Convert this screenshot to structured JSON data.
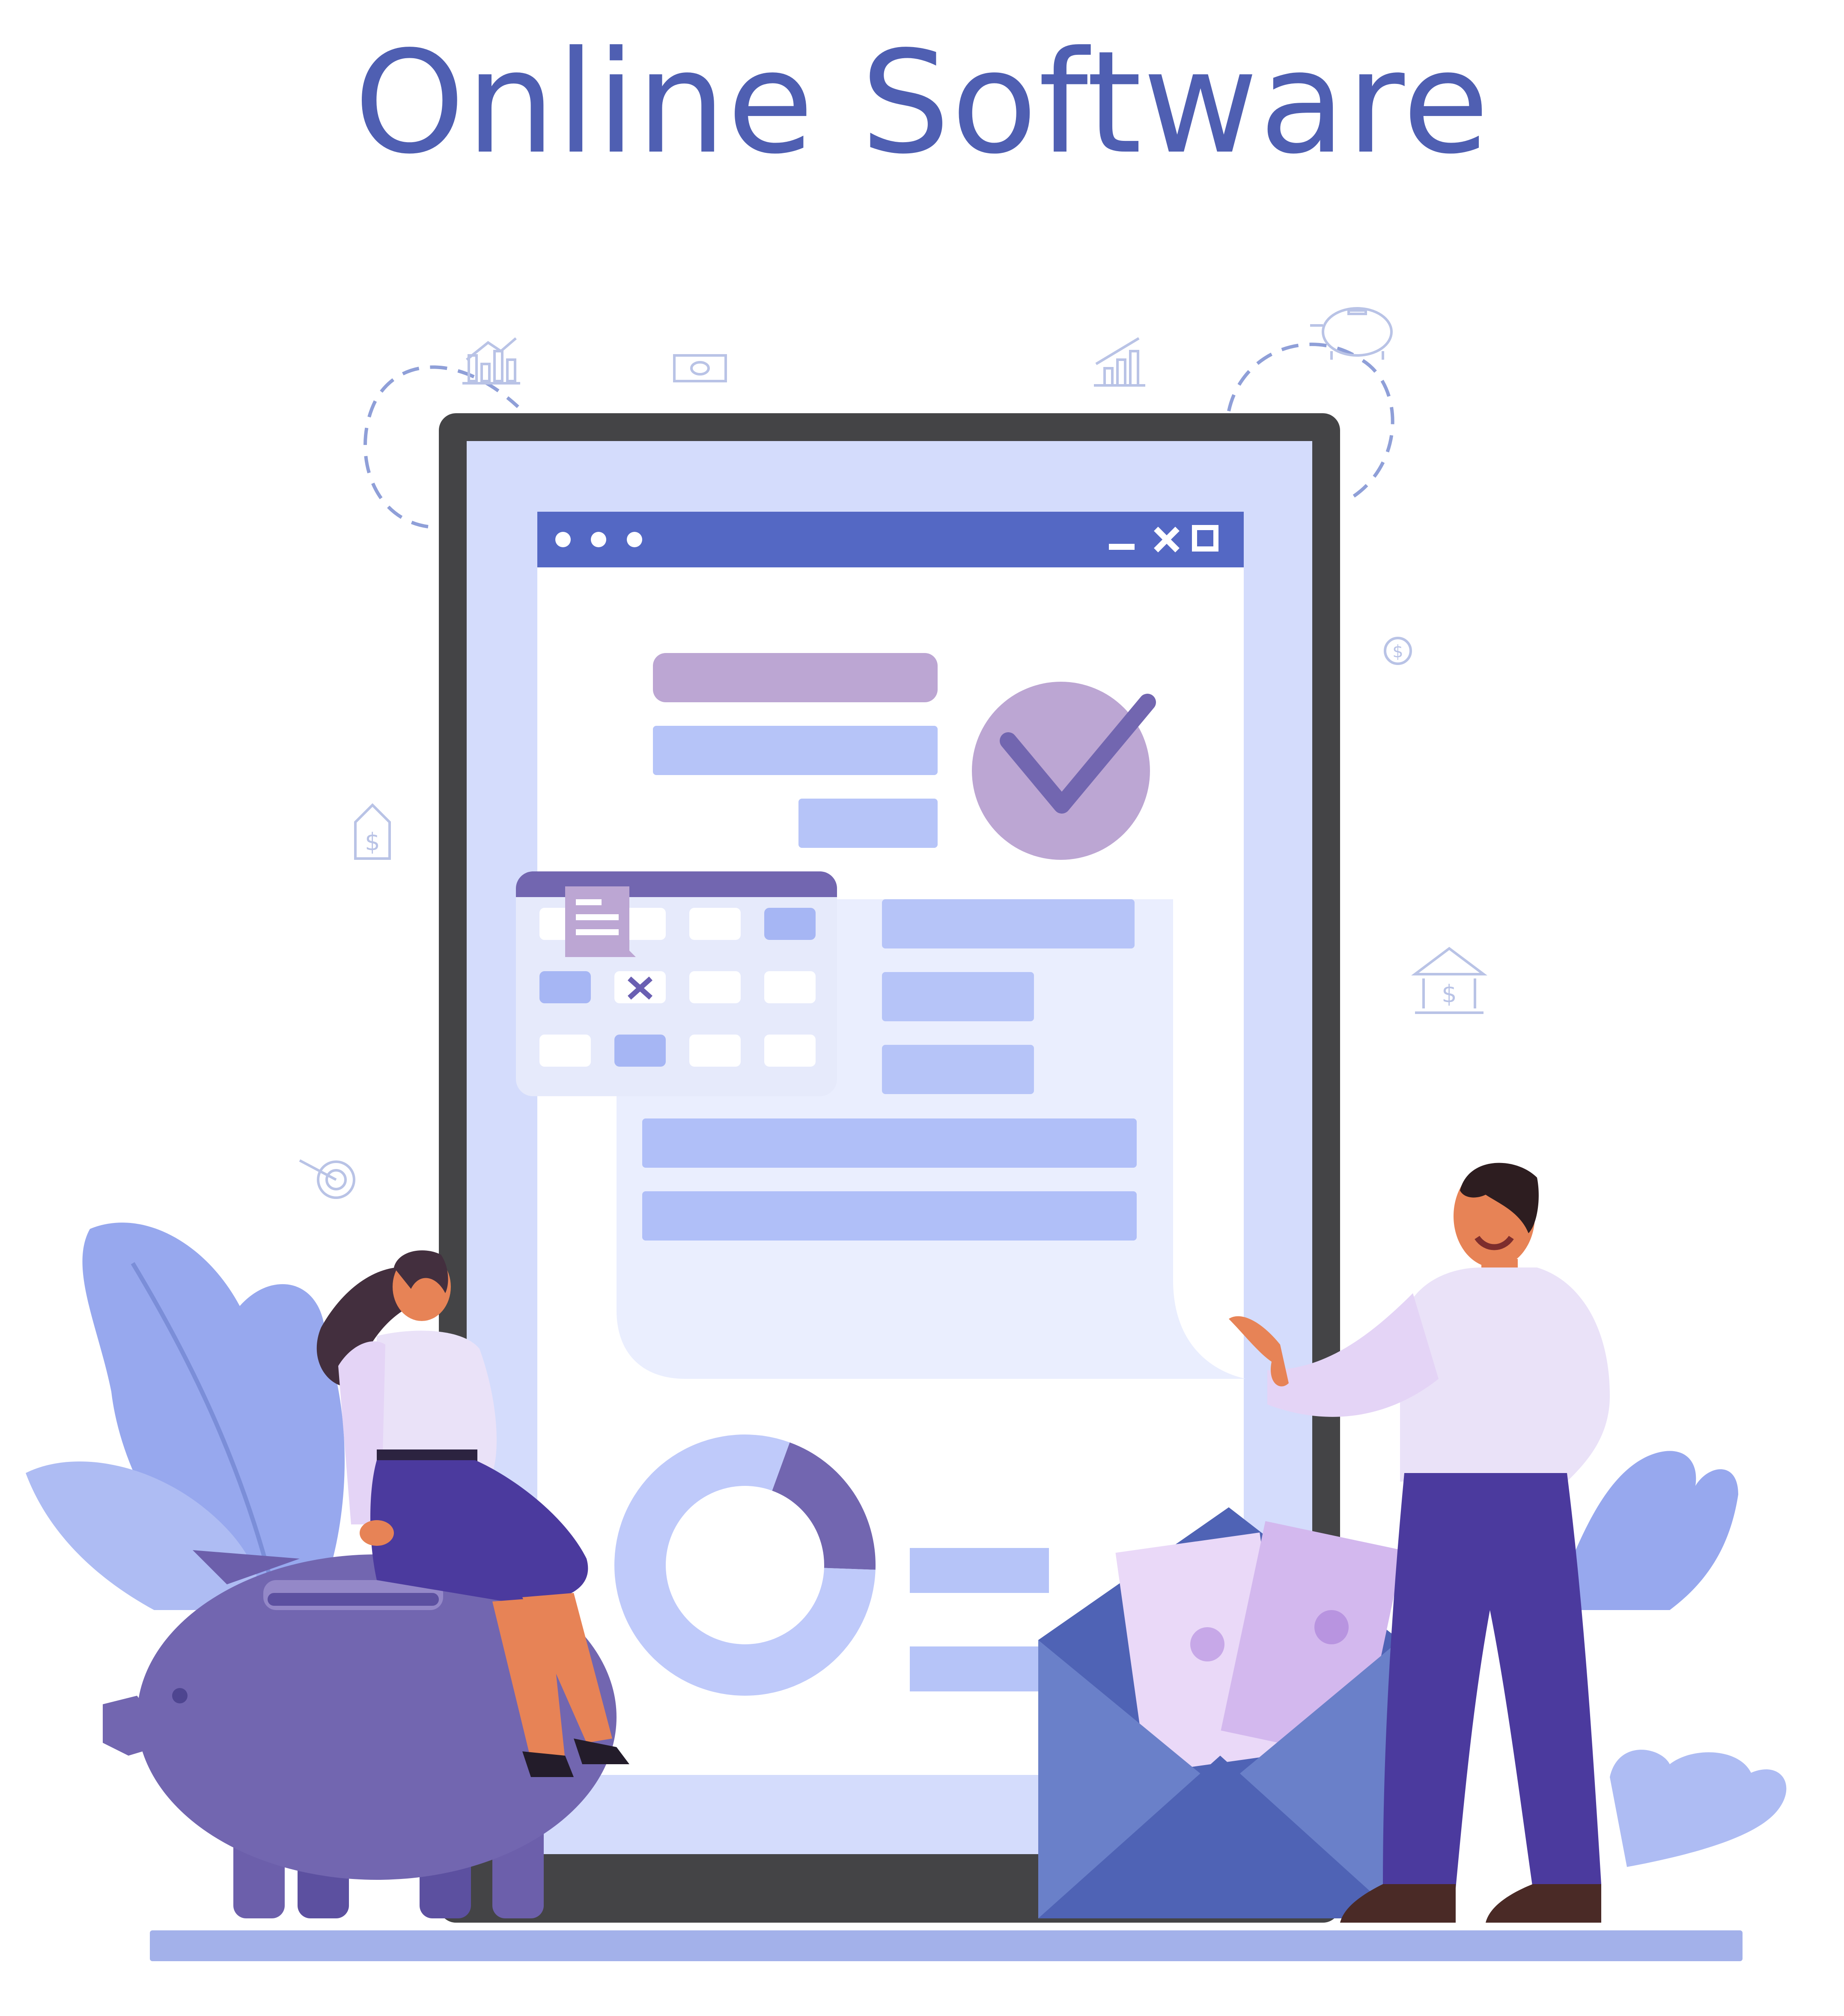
{
  "header": {
    "title": "Online Software"
  },
  "app_window": {
    "controls_left": [
      "dot",
      "dot",
      "dot"
    ],
    "controls_right": [
      "minimize-icon",
      "close-icon",
      "maximize-icon"
    ]
  },
  "icons": [
    "bar-chart-icon",
    "banknote-icon",
    "growth-chart-icon",
    "piggy-bank-icon",
    "dollar-coin-icon",
    "house-dollar-icon",
    "bank-icon",
    "target-icon",
    "checkmark-icon",
    "calendar-icon",
    "donut-chart-icon"
  ],
  "colors": {
    "title": "#4f5fb2",
    "screen": "#d4dcfc",
    "window_bar": "#5468c4",
    "accent_purple": "#7266b0",
    "check_circle": "#bca6d3",
    "form_field": "#b6c4f8",
    "ground": "#a3b1ea"
  },
  "chart_data": {
    "type": "pie",
    "values": [
      0.2,
      0.8
    ]
  }
}
